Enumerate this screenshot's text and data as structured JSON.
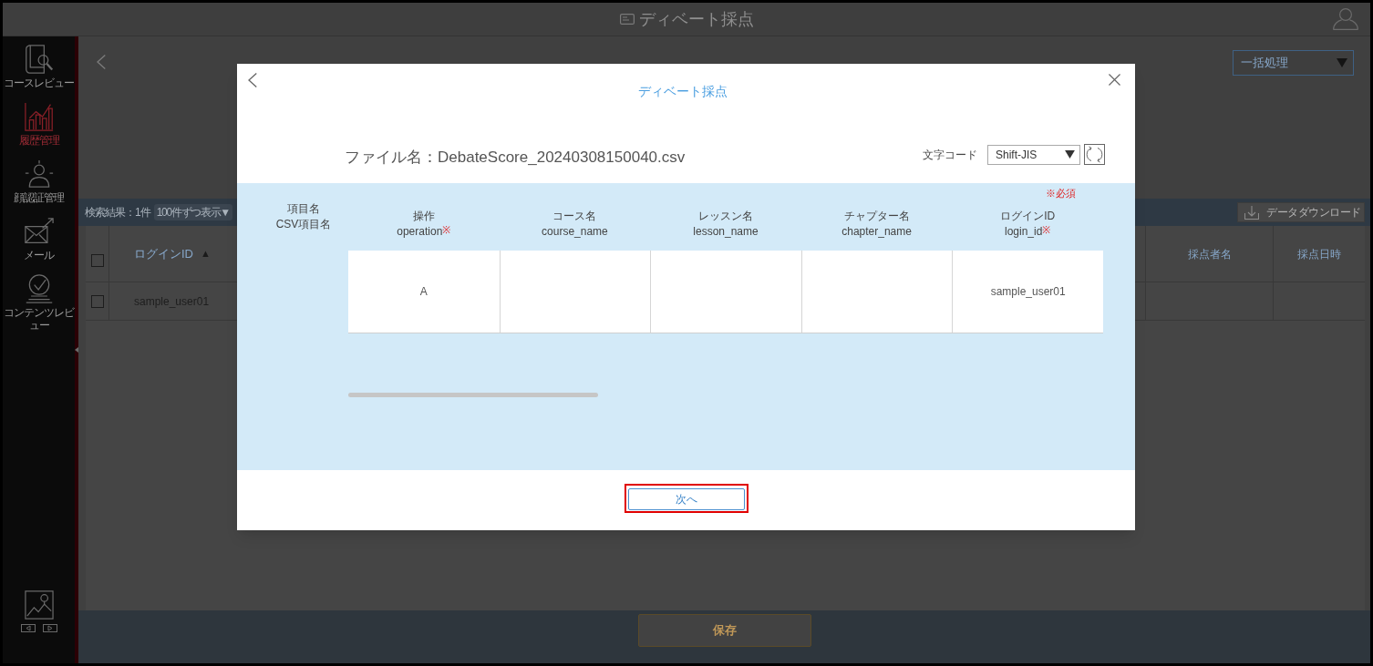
{
  "app_bar": {
    "title": "ディベート採点"
  },
  "sidebar": {
    "items": [
      {
        "label": "コースレビュー",
        "selected": false
      },
      {
        "label": "履歴管理",
        "selected": true
      },
      {
        "label": "顔認証管理",
        "selected": false
      },
      {
        "label": "メール",
        "selected": false
      },
      {
        "label": "コンテンツレビュー",
        "selected": false
      }
    ]
  },
  "page": {
    "bulk_action": {
      "value": "一括処理"
    },
    "results": {
      "count": "検索結果：1件",
      "page_size": "100件ずつ表示▼"
    },
    "download_button": "データダウンロード",
    "table": {
      "select_all": {
        "checked": false
      },
      "columns": [
        {
          "label": "ログインID",
          "sort": "▲"
        },
        {
          "label": "採点者名"
        },
        {
          "label": "採点日時"
        }
      ],
      "rows": [
        {
          "checked": false,
          "login_id": "sample_user01"
        }
      ]
    },
    "save_button": "保存"
  },
  "modal": {
    "title": "ディベート採点",
    "file_name": "ファイル名：DebateScore_20240308150040.csv",
    "encoding": {
      "label": "文字コード",
      "value": "Shift-JIS"
    },
    "required_note": "※必須",
    "row_labels": [
      "項目名",
      "CSV項目名"
    ],
    "columns": [
      {
        "name": "操作",
        "csv_name": "operation",
        "mark": "※",
        "value": "A"
      },
      {
        "name": "コース名",
        "csv_name": "course_name"
      },
      {
        "name": "レッスン名",
        "csv_name": "lesson_name"
      },
      {
        "name": "チャプター名",
        "csv_name": "chapter_name"
      },
      {
        "name": "ログインID",
        "csv_name": "login_id",
        "mark": "※",
        "value": "sample_user01"
      }
    ],
    "next_button": {
      "label": "次へ",
      "highlighted": true
    }
  }
}
